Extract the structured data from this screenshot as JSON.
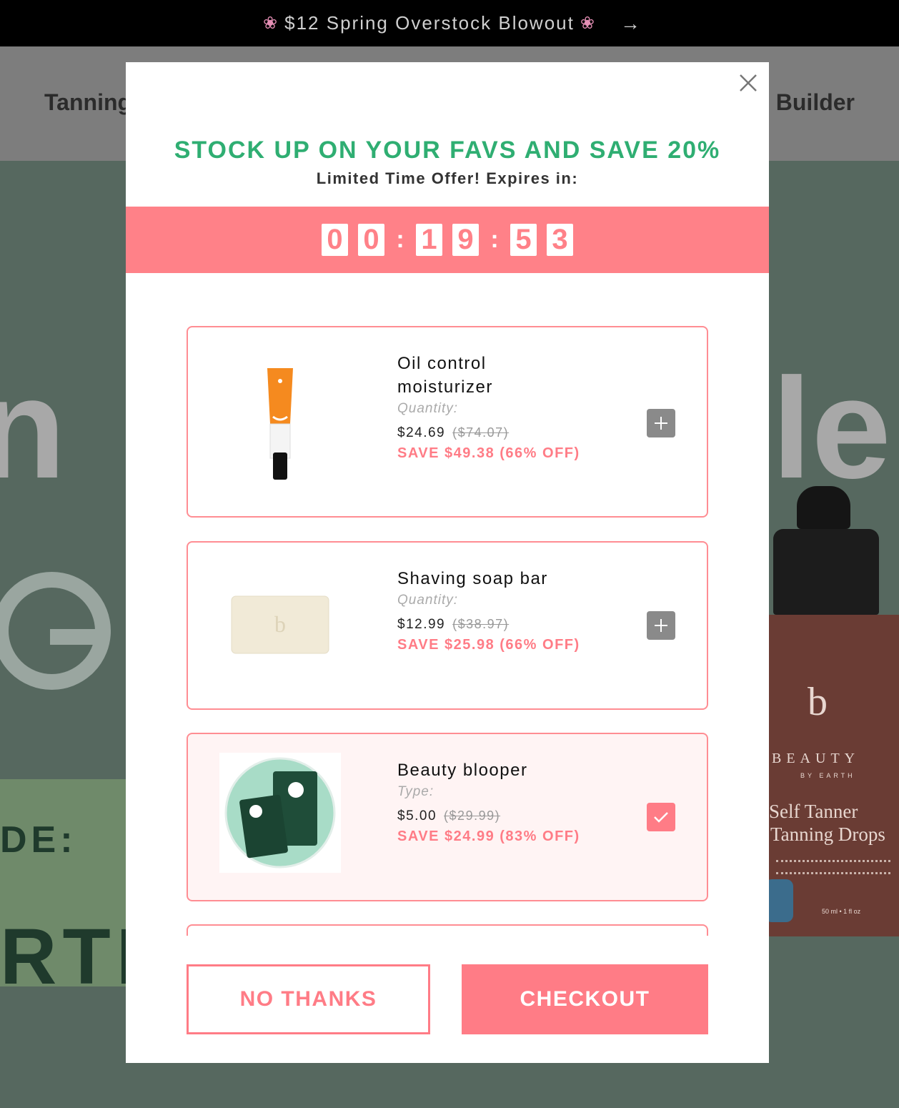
{
  "announcement": {
    "text": "$12 Spring Overstock Blowout",
    "flower": "❀",
    "arrow": "→"
  },
  "nav": {
    "left_label": "Tanning",
    "right_label": "Builder"
  },
  "hero": {
    "text_n": "n",
    "text_le": "le",
    "text_de": "DE:",
    "text_rti": "RTI"
  },
  "bottle": {
    "logo": "b",
    "brand": "BEAUTY",
    "brand_sub": "BY EARTH",
    "name_line1": "Self Tanner",
    "name_line2": "Tanning Drops",
    "volume": "50 ml • 1 fl oz"
  },
  "modal": {
    "headline": "STOCK UP ON YOUR FAVS AND SAVE 20%",
    "subhead": "Limited Time Offer! Expires in:",
    "timer": {
      "digits": [
        "0",
        "0",
        "1",
        "9",
        "5",
        "3"
      ],
      "separator": ":"
    },
    "products": [
      {
        "name": "Oil control moisturizer",
        "meta": "Quantity:",
        "price": "$24.69",
        "old_price": "($74.07)",
        "save": "SAVE $49.38 (66% OFF)",
        "selected": false,
        "toggle_icon": "plus-icon"
      },
      {
        "name": "Shaving soap bar",
        "meta": "Quantity:",
        "price": "$12.99",
        "old_price": "($38.97)",
        "save": "SAVE $25.98 (66% OFF)",
        "selected": false,
        "toggle_icon": "plus-icon"
      },
      {
        "name": "Beauty blooper",
        "meta": "Type:",
        "price": "$5.00",
        "old_price": "($29.99)",
        "save": "SAVE $24.99 (83% OFF)",
        "selected": true,
        "toggle_icon": "checkmark-icon"
      }
    ],
    "no_thanks_label": "NO THANKS",
    "checkout_label": "CHECKOUT"
  },
  "colors": {
    "accent_pink": "#ff7c86",
    "headline_green": "#2fae72",
    "timer_bg": "#ff8188"
  }
}
